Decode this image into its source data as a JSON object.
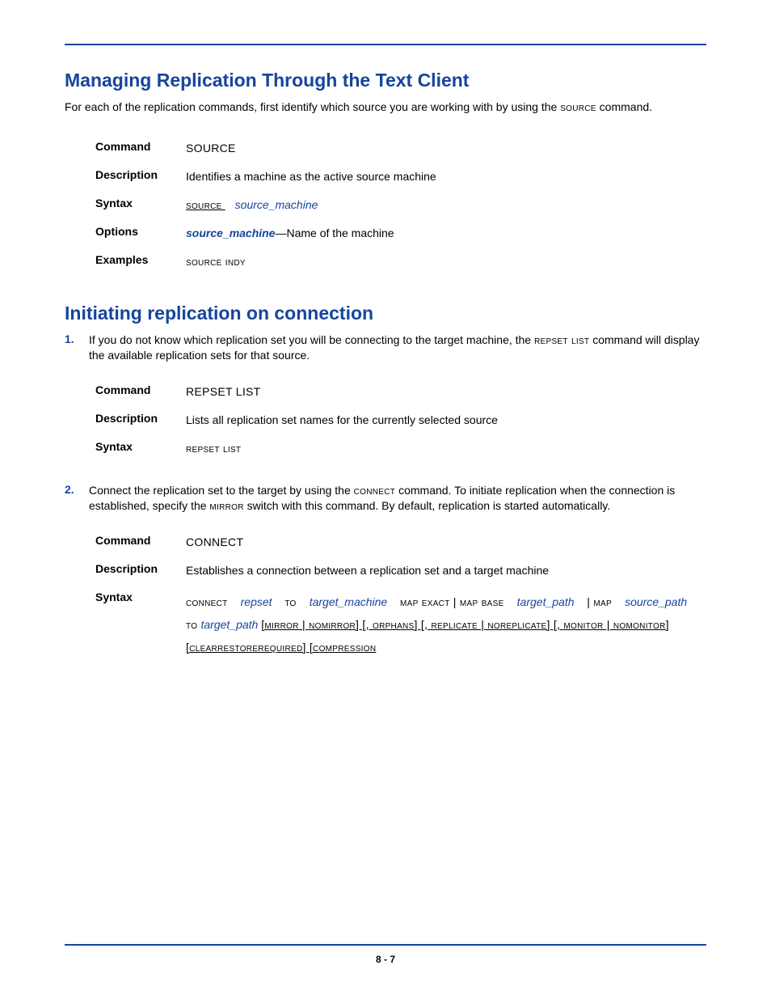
{
  "section1": {
    "title": "Managing Replication Through the Text Client",
    "intro_a": "For each of the replication commands, first identify which source you are working with by using the ",
    "intro_cmd": "source",
    "intro_b": " command.",
    "cmd": {
      "label_command": "Command",
      "command_value": "SOURCE",
      "label_description": "Description",
      "description_value": "Identifies a machine as the active source machine",
      "label_syntax": "Syntax",
      "syntax_prefix": "source ",
      "syntax_param": "source_machine",
      "label_options": "Options",
      "options_param": "source_machine",
      "options_text": "—Name of the machine",
      "label_examples": "Examples",
      "examples_value": "source indy"
    }
  },
  "section2": {
    "title": "Initiating replication on connection",
    "step1": {
      "num": "1.",
      "a": "If you do not know which replication set you will be connecting to the target machine, the ",
      "cmd": "repset list",
      "b": " command will display the available replication sets for that source."
    },
    "cmdA": {
      "label_command": "Command",
      "command_value": "REPSET LIST",
      "label_description": "Description",
      "description_value": "Lists all replication set names for the currently selected source",
      "label_syntax": "Syntax",
      "syntax_value": "repset list"
    },
    "step2": {
      "num": "2.",
      "a": "Connect the replication set to the target by using the ",
      "cmd1": "connect",
      "b": " command. To initiate replication when the connection is established, specify the ",
      "cmd2": "mirror",
      "c": " switch with this command. By default, replication is started automatically."
    },
    "cmdB": {
      "label_command": "Command",
      "command_value": "CONNECT",
      "label_description": "Description",
      "description_value": "Establishes a connection between a replication set and a target machine",
      "label_syntax": "Syntax",
      "syn": {
        "t1": "connect ",
        "p1": "repset",
        "t2": " to ",
        "p2": "target_machine",
        "t3": " map exact | map base ",
        "p3": "target_path",
        "t4": " | map ",
        "p4": "source_path",
        "t5": " to ",
        "p5": "target_path",
        "t6": " [mirror | nomirror] [, orphans] [, replicate | noreplicate] [, ",
        "t7": "monitor | nomonitor] [clearrestorerequired] [compression "
      }
    }
  },
  "page_number": "8 - 7"
}
